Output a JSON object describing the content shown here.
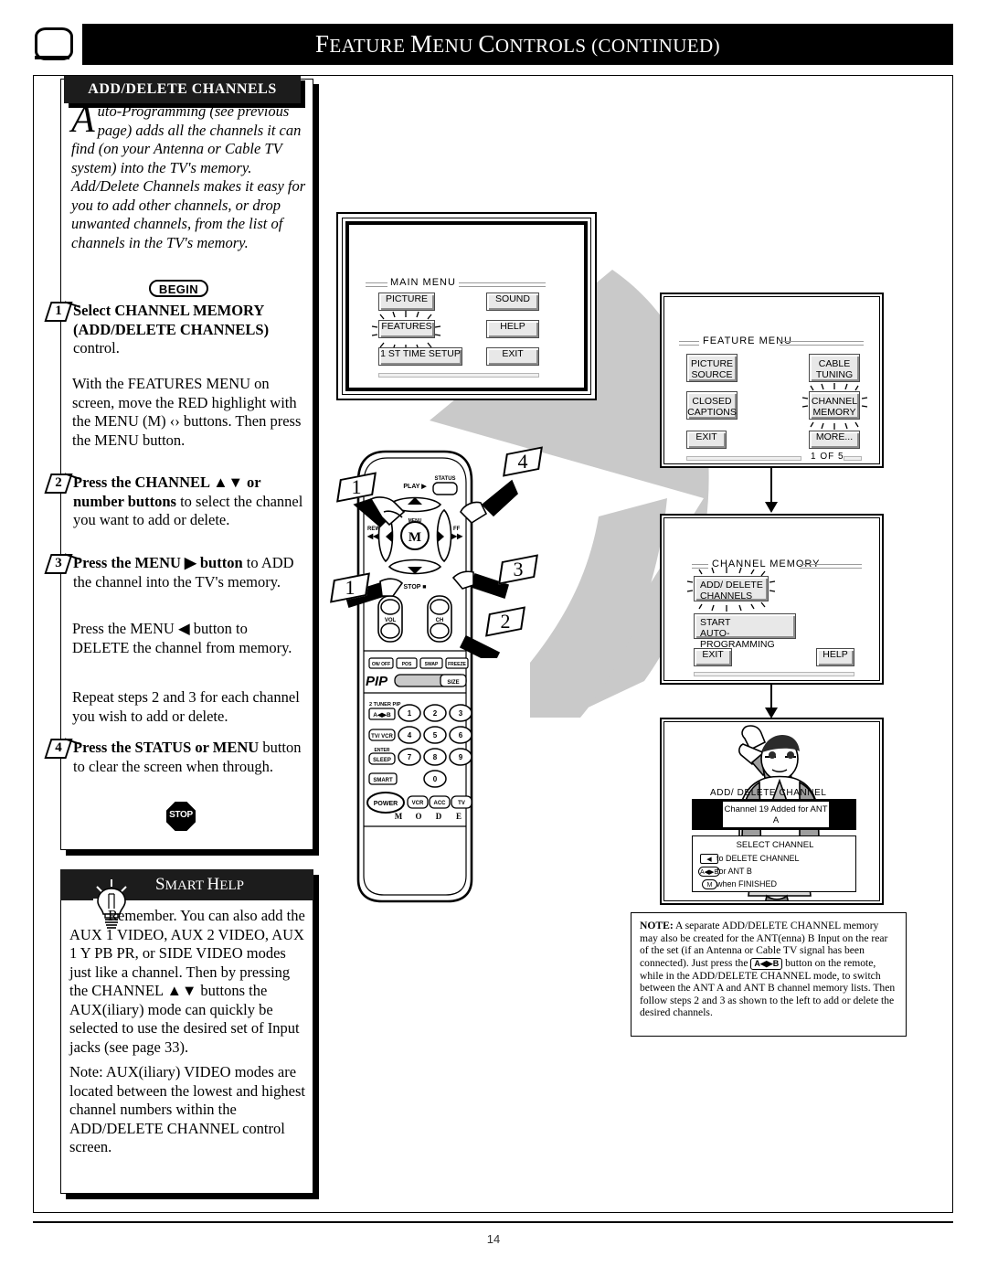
{
  "header": {
    "title_words": [
      "F",
      "EATURE ",
      "M",
      "ENU ",
      "C",
      "ONTROLS (",
      "CONTINUED",
      ")"
    ],
    "title_full": "FEATURE MENU CONTROLS (CONTINUED)",
    "tv_icon": "tv-icon"
  },
  "page_number": "14",
  "section": {
    "tab_label": "ADD/DELETE CHANNELS",
    "intro_dropcap": "A",
    "intro_text": "uto-Programming (see previous page) adds all the channels it can find (on your Antenna or Cable TV system) into the TV's memory. Add/Delete Channels makes it easy for you to add other channels, or drop unwanted channels, from the list of channels in the TV's memory.",
    "begin_label": "BEGIN",
    "stop_label": "STOP"
  },
  "steps": [
    {
      "number": "1",
      "lead": "Select CHANNEL MEMORY (ADD/DELETE CHANNELS)",
      "rest": " control.",
      "follow": "With the FEATURES MENU on screen, move the RED highlight with the MENU (M) ‹› buttons. Then press the MENU button."
    },
    {
      "number": "2",
      "lead": "Press the CHANNEL ▲▼ or number buttons",
      "rest": " to select the channel you want to add or delete.",
      "follow": ""
    },
    {
      "number": "3",
      "lead": "Press the MENU ▶ button",
      "rest": " to ADD the channel into the TV's memory.",
      "follow": "Press the MENU ◀ button to DELETE the channel from memory.",
      "follow2": "Repeat steps 2 and 3 for each channel you wish to add or delete."
    },
    {
      "number": "4",
      "lead": "Press the STATUS or MENU",
      "rest": " button to clear the screen when through.",
      "follow": ""
    }
  ],
  "smart_help": {
    "title": "SMART HELP",
    "title_words": [
      "S",
      "MART ",
      "H",
      "ELP"
    ],
    "icon": "lightbulb-icon",
    "paragraph1": "Remember. You can also add the AUX 1 VIDEO, AUX 2 VIDEO, AUX 1 Y PB PR, or SIDE VIDEO modes just like a channel. Then by pressing the CHANNEL ▲▼ buttons the AUX(iliary) mode can quickly be selected to use the desired set of Input jacks (see page 33).",
    "paragraph2": "Note: AUX(iliary) VIDEO modes are located between the lowest and highest channel numbers within the ADD/DELETE CHANNEL control screen."
  },
  "main_menu_screen": {
    "title": "MAIN MENU",
    "buttons_left": [
      "PICTURE",
      "FEATURES",
      "1 ST TIME SETUP"
    ],
    "buttons_right": [
      "SOUND",
      "HELP",
      "EXIT"
    ],
    "highlighted": "FEATURES"
  },
  "feature_menu_screen": {
    "title": "FEATURE MENU",
    "buttons_left": [
      [
        "PICTURE",
        "SOURCE"
      ],
      [
        "CLOSED",
        "CAPTIONS"
      ],
      [
        "EXIT"
      ]
    ],
    "buttons_right": [
      [
        "CABLE",
        "TUNING"
      ],
      [
        "CHANNEL",
        "MEMORY"
      ],
      [
        "MORE..."
      ]
    ],
    "highlighted": "CHANNEL MEMORY",
    "page_indicator": "1 OF 5"
  },
  "channel_memory_screen": {
    "title": "CHANNEL MEMORY",
    "button_addelete": [
      "ADD/ DELETE",
      "CHANNELS"
    ],
    "button_autoprog": [
      "START",
      "AUTO-PROGRAMMING"
    ],
    "button_exit": "EXIT",
    "button_help": "HELP",
    "highlighted": "ADD/ DELETE CHANNELS"
  },
  "add_delete_screen": {
    "overlay_title": "ADD/ DELETE CHANNEL",
    "message_line1": "Channel 19 Added",
    "message_line2": "for ANT A",
    "guide_title": "SELECT CHANNEL",
    "guide_rows": [
      {
        "key": "◀",
        "key_type": "left-arrow-key",
        "text": "to DELETE CHANNEL"
      },
      {
        "key": "A◀▶B",
        "key_type": "ant-ab-key",
        "text": "for ANT B"
      },
      {
        "key": "M",
        "key_type": "menu-key",
        "text": "when FINISHED"
      }
    ]
  },
  "note_box": {
    "label": "NOTE:",
    "key_glyph": "A◀▶B",
    "text_part1": " A separate ADD/DELETE CHANNEL memory may also be created for the ANT(enna) B Input on the rear of the set (if an Antenna or Cable TV signal has been connected). Just press the ",
    "text_part2": " button on the remote, while in the ADD/DELETE CHANNEL mode, to switch between the ANT A and ANT B channel memory lists. Then follow steps 2 and 3 as shown to the left to add or delete the desired channels."
  },
  "remote": {
    "callouts": [
      "1",
      "4",
      "1",
      "3",
      "2"
    ],
    "labels": {
      "play": "PLAY ▶",
      "status": "STATUS",
      "rew": "REW",
      "ff": "FF",
      "menu_center": "M",
      "menu_small": "MENU",
      "stop": "STOP ■",
      "vol": "VOL",
      "ch": "CH",
      "pip_row": [
        "ON/ OFF",
        "POS",
        "SWAP",
        "FREEZE"
      ],
      "pip": "PIP",
      "size": "SIZE",
      "tuner_pip": "2 TUNER PIP",
      "ant_key": "A◀▶B",
      "tv_vcr": "TV/ VCR",
      "enter": "ENTER",
      "sleep": "SLEEP",
      "smart": "SMART",
      "power": "POWER",
      "mode_keys": [
        "VCR",
        "ACC",
        "TV"
      ],
      "mode_letters": [
        "M",
        "O",
        "D",
        "E"
      ],
      "numbers": [
        "1",
        "2",
        "3",
        "4",
        "5",
        "6",
        "7",
        "8",
        "9",
        "0"
      ]
    }
  },
  "colors": {
    "ink": "#000000",
    "header_bg": "#000000",
    "osd_button": "#e8e8e8",
    "swoosh": "#c9c9c9"
  }
}
